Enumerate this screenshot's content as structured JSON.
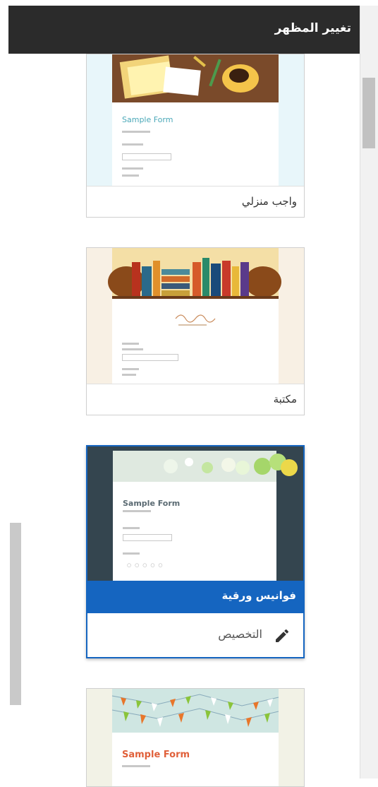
{
  "header": {
    "title": "تغيير المظهر"
  },
  "themes": [
    {
      "label": "واجب منزلي",
      "form_title": "Sample Form",
      "selected": false
    },
    {
      "label": "مكتبة",
      "form_title": "",
      "selected": false
    },
    {
      "label": "فوانيس ورقية",
      "form_title": "Sample Form",
      "selected": true
    },
    {
      "label": "",
      "form_title": "Sample Form",
      "selected": false
    }
  ],
  "customize": {
    "label": "التخصيص",
    "icon": "pencil-icon"
  },
  "colors": {
    "header_bg": "#2b2b2b",
    "selected_accent": "#1565c0"
  }
}
